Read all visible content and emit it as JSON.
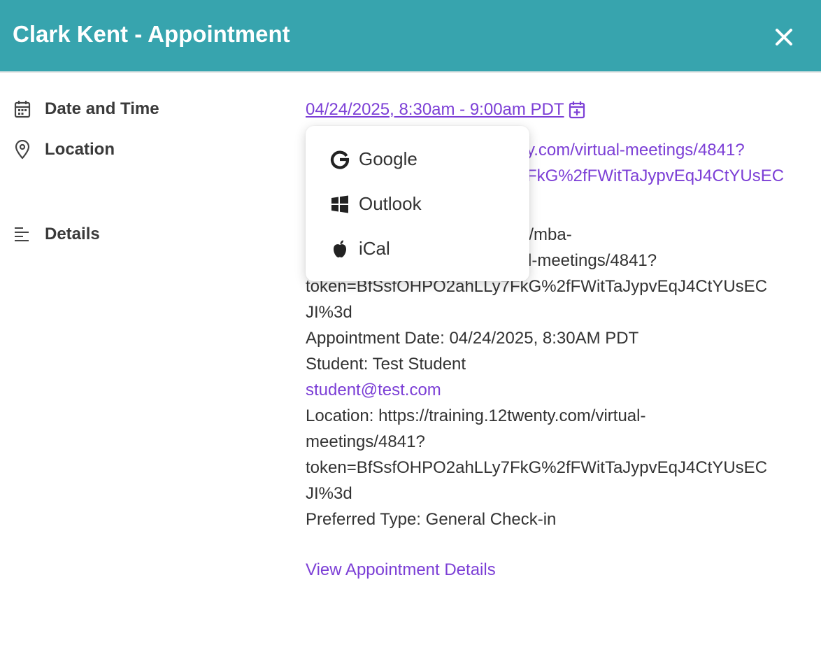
{
  "header": {
    "title": "Clark Kent - Appointment",
    "close_icon": "close-icon",
    "background": "#37a4ae"
  },
  "labels": {
    "date_time": "Date and Time",
    "location": "Location",
    "details": "Details"
  },
  "appointment": {
    "datetime": "04/24/2025, 8:30am - 9:00am PDT",
    "location_line1_visible": "y.com/virtual-meetings/4841?",
    "location_line2_visible": "FkG%2fFWitTaJypvEqJ4CtYUsEC"
  },
  "details": {
    "line1_visible": "://mba-",
    "line2_visible": "l-meetings/4841?",
    "line3": "token=BfSsfOHPO2ahLLy7FkG%2fFWitTaJypvEqJ4CtYUsEC",
    "line4": "JI%3d",
    "appointment_date": "Appointment Date: 04/24/2025, 8:30AM PDT",
    "student": "Student: Test Student",
    "email": "student@test.com",
    "location_line1": "Location: https://training.12twenty.com/virtual-",
    "location_line2": "meetings/4841?",
    "location_line3": "token=BfSsfOHPO2ahLLy7FkG%2fFWitTaJypvEqJ4CtYUsEC",
    "location_line4": "JI%3d",
    "preferred_type": "Preferred Type: General Check-in"
  },
  "calendar_menu": {
    "items": [
      {
        "label": "Google",
        "icon": "google-icon"
      },
      {
        "label": "Outlook",
        "icon": "windows-icon"
      },
      {
        "label": "iCal",
        "icon": "apple-icon"
      }
    ]
  },
  "footer": {
    "view_details": "View Appointment Details"
  },
  "colors": {
    "link": "#7c3fd6",
    "text": "#333333"
  }
}
